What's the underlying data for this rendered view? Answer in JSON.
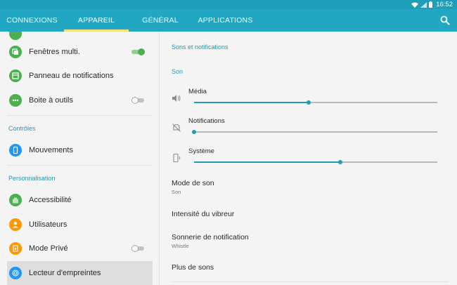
{
  "status": {
    "time": "16:52"
  },
  "tabs": [
    {
      "label": "CONNEXIONS",
      "active": false
    },
    {
      "label": "APPAREIL",
      "active": true
    },
    {
      "label": "GÉNÉRAL",
      "active": false
    },
    {
      "label": "APPLICATIONS",
      "active": false
    }
  ],
  "sidebar": {
    "items": [
      {
        "label": "Fenêtres multi.",
        "icon": "multi-window-icon",
        "color": "#4caf50",
        "toggle": "on"
      },
      {
        "label": "Panneau de notifications",
        "icon": "notification-panel-icon",
        "color": "#4caf50"
      },
      {
        "label": "Boite à outils",
        "icon": "toolbox-icon",
        "color": "#4caf50",
        "toggle": "off"
      },
      {
        "label": "Mouvements",
        "icon": "motion-icon",
        "color": "#2196f3"
      },
      {
        "label": "Accessibilité",
        "icon": "accessibility-icon",
        "color": "#4caf50"
      },
      {
        "label": "Utilisateurs",
        "icon": "users-icon",
        "color": "#ff9800"
      },
      {
        "label": "Mode Privé",
        "icon": "private-mode-icon",
        "color": "#ff9800",
        "toggle": "off"
      },
      {
        "label": "Lecteur d'empreintes",
        "icon": "fingerprint-icon",
        "color": "#2196f3",
        "selected": true
      }
    ],
    "sections": {
      "controls": "Contrôles",
      "personalisation": "Personnalisation"
    }
  },
  "main": {
    "title": "Sons et notifications",
    "sound_header": "Son",
    "volumes": [
      {
        "label": "Média",
        "icon": "speaker-icon",
        "level": 0.47
      },
      {
        "label": "Notifications",
        "icon": "notification-muted-icon",
        "level": 0.0
      },
      {
        "label": "Système",
        "icon": "system-sound-icon",
        "level": 0.6
      }
    ],
    "settings": [
      {
        "title": "Mode de son",
        "subtitle": "Son"
      },
      {
        "title": "Intensité du vibreur",
        "subtitle": ""
      },
      {
        "title": "Sonnerie de notification",
        "subtitle": "Whistle"
      },
      {
        "title": "Plus de sons",
        "subtitle": ""
      }
    ]
  },
  "colors": {
    "accent": "#22a7c2",
    "indicator": "#f6e27b"
  }
}
